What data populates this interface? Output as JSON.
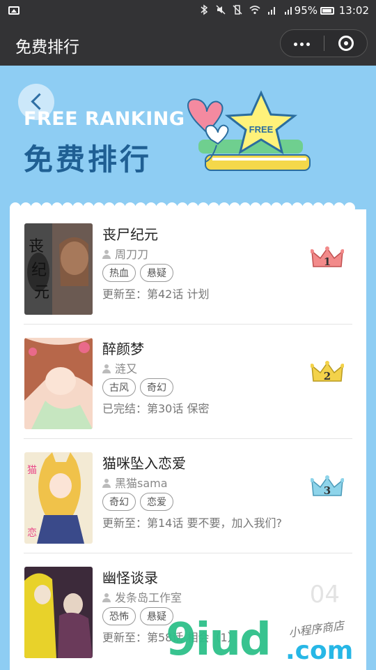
{
  "status_bar": {
    "battery": "95%",
    "time": "13:02"
  },
  "nav": {
    "title": "免费排行"
  },
  "banner": {
    "title_en": "FREE RANKING",
    "title_cn": "免费排行",
    "badge": "FREE"
  },
  "list": [
    {
      "title": "丧尸纪元",
      "author": "周刀刀",
      "tags": [
        "热血",
        "悬疑"
      ],
      "update": "更新至：第42话 计划",
      "rank": "1",
      "crown_color": "#f28a8a"
    },
    {
      "title": "醉颜梦",
      "author": "涟又",
      "tags": [
        "古风",
        "奇幻"
      ],
      "update": "已完结：第30话 保密",
      "rank": "2",
      "crown_color": "#f3d24a"
    },
    {
      "title": "猫咪坠入恋爱",
      "author": "黑猫sama",
      "tags": [
        "奇幻",
        "恋爱"
      ],
      "update": "更新至：第14话 要不要，加入我们?",
      "rank": "3",
      "crown_color": "#8ed4ea"
    },
    {
      "title": "幽怪谈录",
      "author": "发条岛工作室",
      "tags": [
        "恐怖",
        "悬疑"
      ],
      "update": "更新至：第58话 相会（1）",
      "rank": "04"
    }
  ],
  "watermark": {
    "main": "9iud",
    "suffix": ".com",
    "cn": "小程序商店"
  }
}
